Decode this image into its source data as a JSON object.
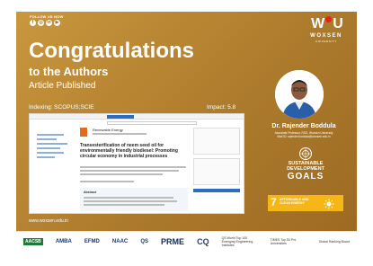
{
  "social": {
    "follow_label": "FOLLOW US NOW",
    "icons": [
      "facebook-icon",
      "instagram-icon",
      "linkedin-icon",
      "youtube-icon"
    ]
  },
  "brand": {
    "name": "WOXSEN",
    "sub": "UNIVERSITY",
    "accent": "#e2231a"
  },
  "headline": {
    "title": "Congratulations",
    "subtitle": "to the Authors",
    "status": "Article Published"
  },
  "indexing": "Indexing: SCOPUS;SCIE",
  "impact": "Impact: 5.8",
  "author": {
    "name": "Dr. Rajender Boddula",
    "role": "Associate Professor, RDS, Woxsen University",
    "email": "Mail ID: rajender.boddula@woxsen.edu.in"
  },
  "paper": {
    "journal": "Renewable Energy",
    "title": "Transesterification of neem seed oil for environmentally friendly biodiesel: Promoting circular economy in industrial processes",
    "abstract_label": "Abstract"
  },
  "website": "www.woxsen.edu.in",
  "sdg": {
    "line1": "SUSTAINABLE",
    "line2": "DEVELOPMENT",
    "goals": "GOALS",
    "number": "7",
    "goal_text": "AFFORDABLE AND CLEAN ENERGY",
    "colors": {
      "card": "#f6b615"
    }
  },
  "footer": {
    "accreditations": [
      "AACSB",
      "AMBA",
      "EFMD",
      "NAAC",
      "QS",
      "PRME",
      "CQ"
    ],
    "rankings": [
      "QS World Top 100 Emerging Engineering Institutes",
      "TIMES Top 50 Pvt. Universities",
      "Global Ranking Board"
    ]
  },
  "colors": {
    "background": "#ad7b2c",
    "paper": "#ffffff",
    "link_blue": "#2e6dbd"
  }
}
